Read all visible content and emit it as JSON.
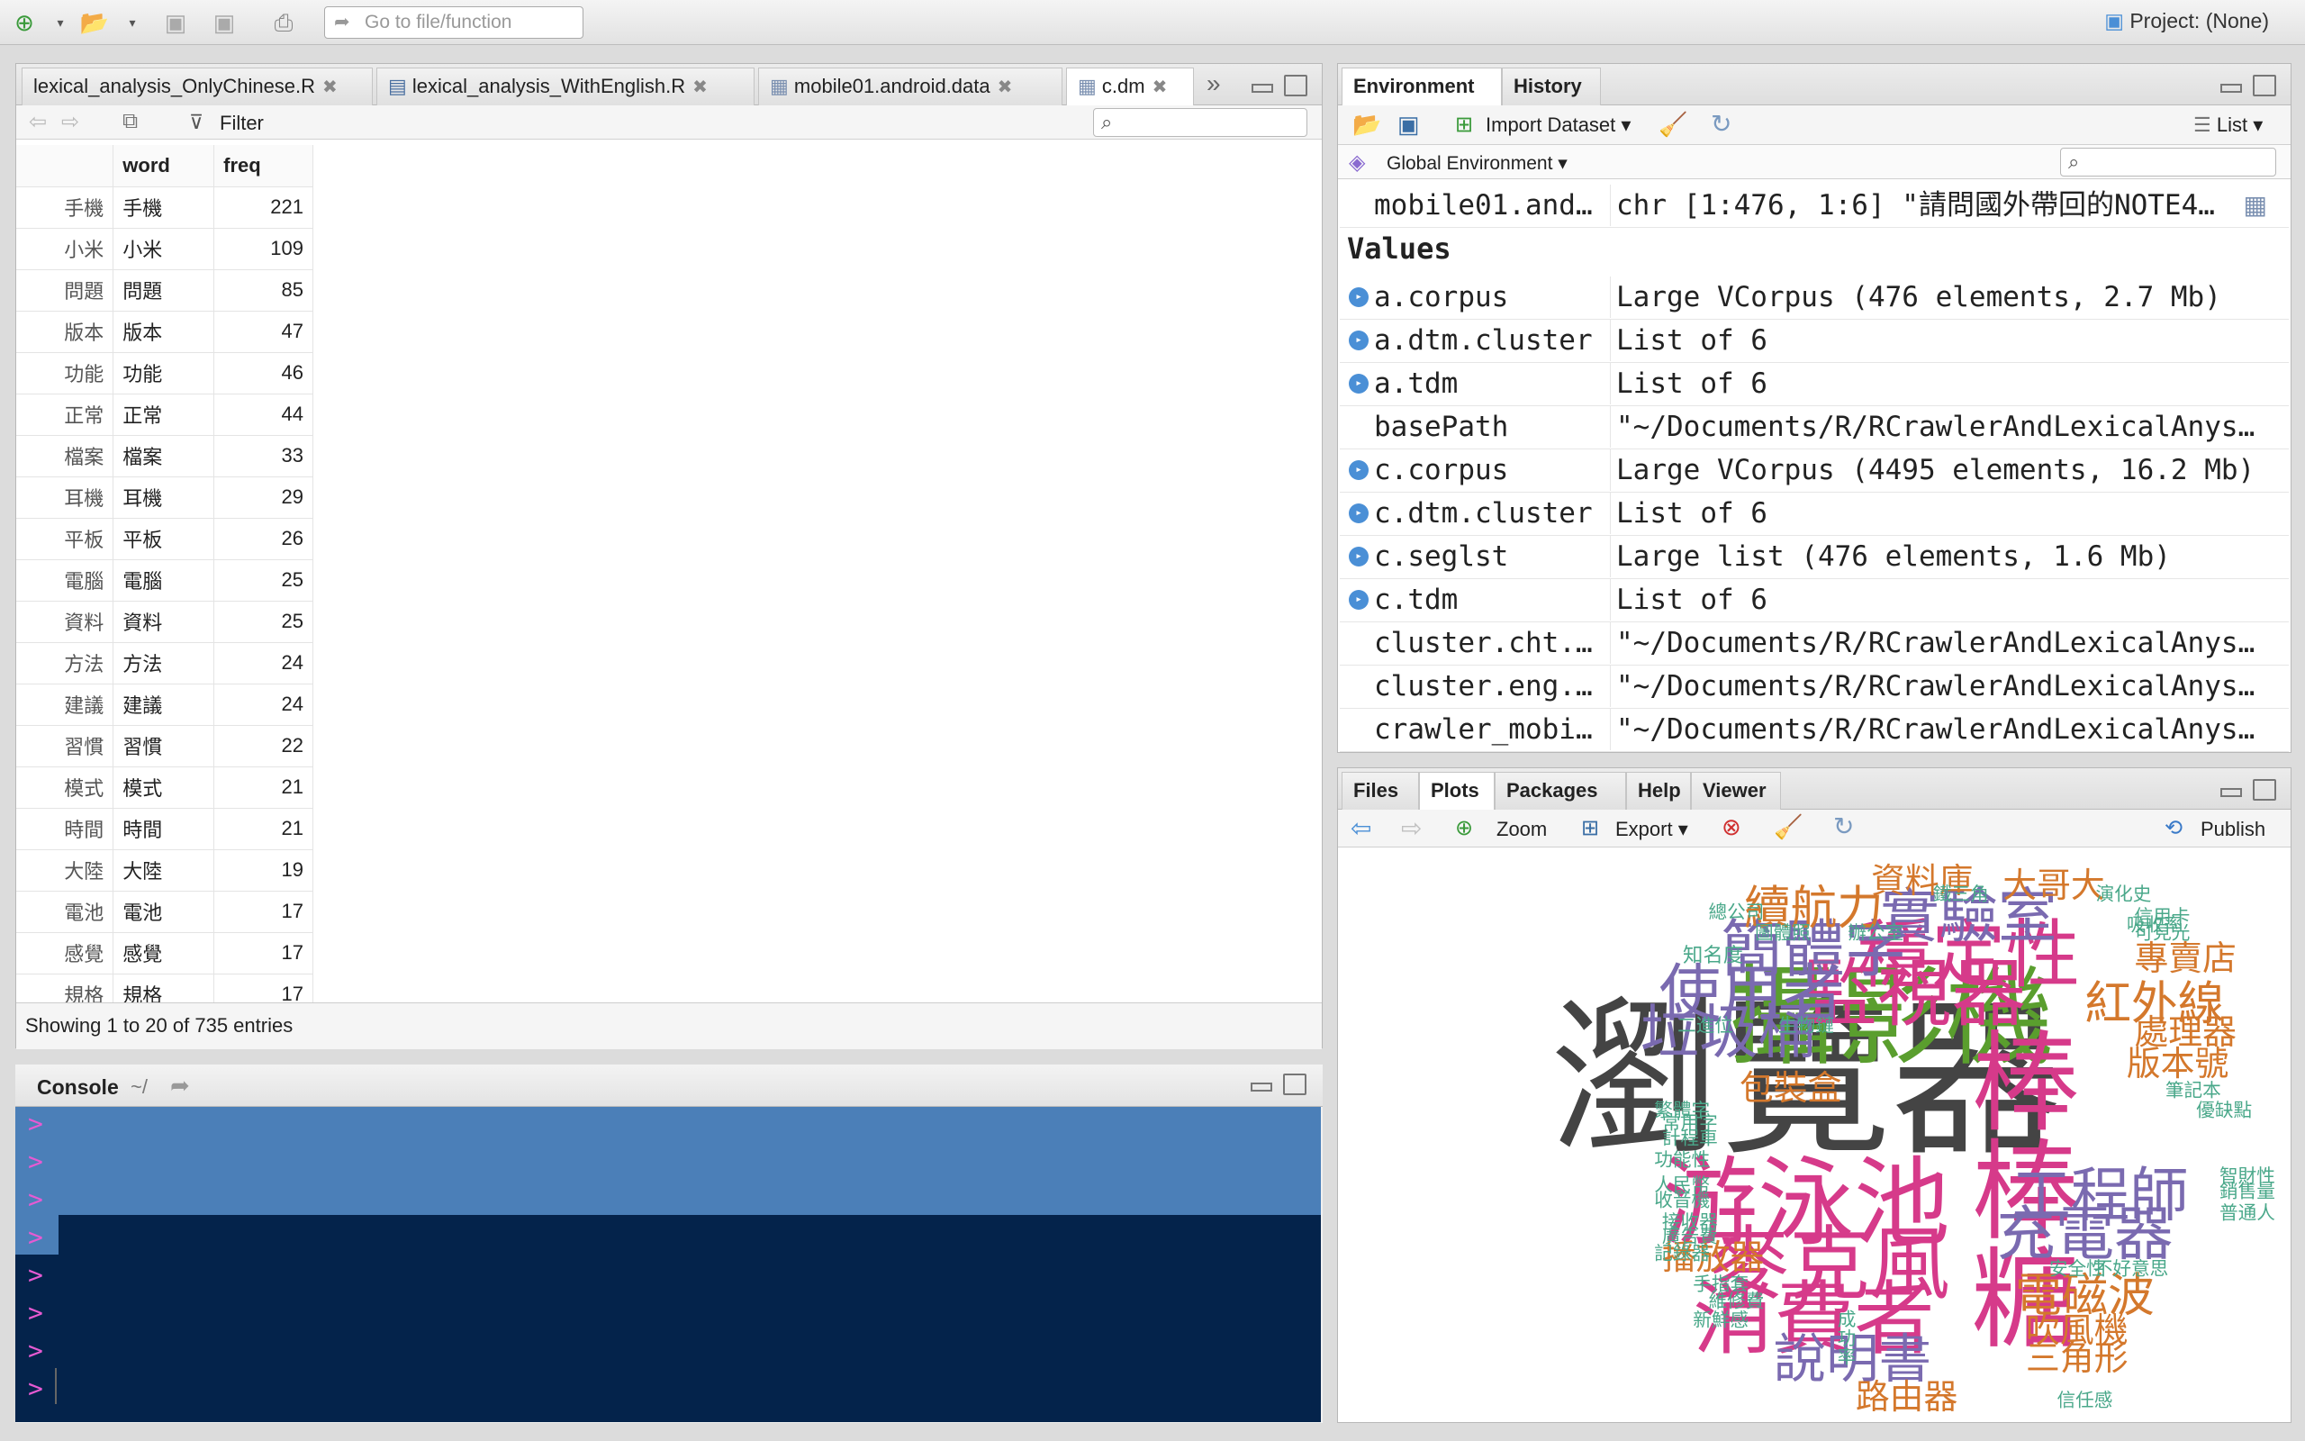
{
  "toolbar": {
    "goto_placeholder": "Go to file/function",
    "project_label": "Project: (None)"
  },
  "source": {
    "tabs": [
      {
        "label": "lexical_analysis_OnlyChinese.R"
      },
      {
        "label": "lexical_analysis_WithEnglish.R"
      },
      {
        "label": "mobile01.android.data"
      },
      {
        "label": "c.dm"
      }
    ],
    "filter_label": "Filter",
    "columns": [
      "word",
      "freq"
    ],
    "rows": [
      [
        "手機",
        "手機",
        "221"
      ],
      [
        "小米",
        "小米",
        "109"
      ],
      [
        "問題",
        "問題",
        "85"
      ],
      [
        "版本",
        "版本",
        "47"
      ],
      [
        "功能",
        "功能",
        "46"
      ],
      [
        "正常",
        "正常",
        "44"
      ],
      [
        "檔案",
        "檔案",
        "33"
      ],
      [
        "耳機",
        "耳機",
        "29"
      ],
      [
        "平板",
        "平板",
        "26"
      ],
      [
        "電腦",
        "電腦",
        "25"
      ],
      [
        "資料",
        "資料",
        "25"
      ],
      [
        "方法",
        "方法",
        "24"
      ],
      [
        "建議",
        "建議",
        "24"
      ],
      [
        "習慣",
        "習慣",
        "22"
      ],
      [
        "模式",
        "模式",
        "21"
      ],
      [
        "時間",
        "時間",
        "21"
      ],
      [
        "大陸",
        "大陸",
        "19"
      ],
      [
        "電池",
        "電池",
        "17"
      ],
      [
        "感覺",
        "感覺",
        "17"
      ],
      [
        "規格",
        "規格",
        "17"
      ]
    ],
    "status": "Showing 1 to 20 of 735 entries"
  },
  "console": {
    "title": "Console",
    "path": "~/",
    "prompt": ">"
  },
  "env": {
    "tabs": [
      "Environment",
      "History"
    ],
    "import_label": "Import Dataset",
    "list_label": "List",
    "scope_label": "Global Environment",
    "data_row": {
      "name": "mobile01.andr…",
      "value": "chr [1:476, 1:6] \"請問國外帶回的NOTE4介…"
    },
    "values_header": "Values",
    "values": [
      {
        "name": "a.corpus",
        "value": "Large VCorpus (476 elements, 2.7 Mb)",
        "expand": true
      },
      {
        "name": "a.dtm.cluster",
        "value": "List of 6",
        "expand": true
      },
      {
        "name": "a.tdm",
        "value": "List of 6",
        "expand": true
      },
      {
        "name": "basePath",
        "value": "\"~/Documents/R/RCrawlerAndLexicalAnysi…",
        "expand": false
      },
      {
        "name": "c.corpus",
        "value": "Large VCorpus (4495 elements, 16.2 Mb)",
        "expand": true
      },
      {
        "name": "c.dtm.cluster",
        "value": "List of 6",
        "expand": true
      },
      {
        "name": "c.seglst",
        "value": "Large list (476 elements, 1.6 Mb)",
        "expand": true
      },
      {
        "name": "c.tdm",
        "value": "List of 6",
        "expand": true
      },
      {
        "name": "cluster.cht.p…",
        "value": "\"~/Documents/R/RCrawlerAndLexicalAnysi…",
        "expand": false
      },
      {
        "name": "cluster.eng.p…",
        "value": "\"~/Documents/R/RCrawlerAndLexicalAnysi…",
        "expand": false
      },
      {
        "name": "crawler_mobil…",
        "value": "\"~/Documents/R/RCrawlerAndLexicalAnysi…",
        "expand": false
      }
    ]
  },
  "files": {
    "tabs": [
      "Files",
      "Plots",
      "Packages",
      "Help",
      "Viewer"
    ],
    "zoom_label": "Zoom",
    "export_label": "Export",
    "publish_label": "Publish"
  },
  "wordcloud": {
    "words": [
      "瀏覽器",
      "攝影機",
      "游泳池",
      "棒棒糖",
      "麥克風",
      "消費者",
      "穩定性",
      "監視器",
      "工程師",
      "充電器",
      "實驗室",
      "簡體字",
      "使用者",
      "垃圾桶",
      "續航力",
      "紅外線",
      "電磁波",
      "說明書",
      "資料庫",
      "大哥大",
      "專賣店",
      "處理器",
      "版本號",
      "播放器",
      "吹風機",
      "三角形",
      "路由器",
      "包裝盒",
      "知名度",
      "總公司",
      "圖體照",
      "辦公室",
      "鐵三角",
      "演化史",
      "信用卡",
      "可見光",
      "二進位",
      "生物鏈",
      "筆記本",
      "優缺點",
      "繁體字",
      "常用字",
      "計程車",
      "功能性",
      "人民幣",
      "收音機",
      "接收器",
      "廣告費",
      "記錄器",
      "智財性",
      "銷售量",
      "普通人",
      "安全性",
      "手指套",
      "不好意思",
      "維修費",
      "新鮮感",
      "成功率",
      "信任感",
      "吸收率"
    ]
  }
}
